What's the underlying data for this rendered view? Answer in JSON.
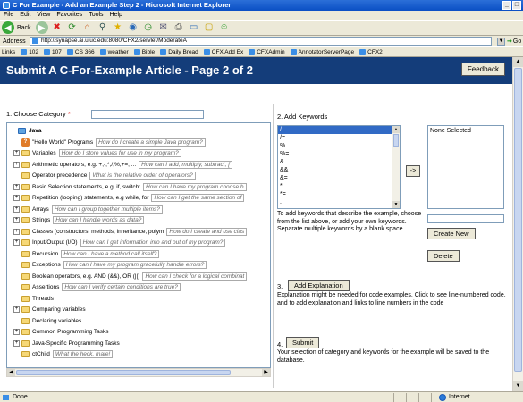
{
  "window": {
    "title": "C For Example - Add an Example Step 2 - Microsoft Internet Explorer",
    "buttons": [
      "_",
      "□"
    ]
  },
  "menu": [
    "File",
    "Edit",
    "View",
    "Favorites",
    "Tools",
    "Help"
  ],
  "toolbar": {
    "back_label": "Back"
  },
  "address": {
    "label": "Address",
    "url": "http://synapse.ai.uiuc.edu:8080/CFX2/servlet/ModerateA",
    "go_label": "Go"
  },
  "links": {
    "label": "Links",
    "items": [
      "102",
      "107",
      "CS 366",
      "weather",
      "Bible",
      "Daily Bread",
      "CFX Add Ex",
      "CFXAdmin",
      "AnnotatorServerPage",
      "CFX2"
    ]
  },
  "page": {
    "title": "Submit A C-For-Example Article - Page 2 of 2",
    "feedback_label": "Feedback"
  },
  "category": {
    "label": "1. Choose Category",
    "required_mark": "*",
    "value": "",
    "tree": [
      {
        "label": "Java",
        "bold": true,
        "icon": "root",
        "expand": "",
        "indent": 0
      },
      {
        "label": "\"Hello World\" Programs",
        "hint": "How do I create a simple Java program?",
        "icon": "q",
        "expand": "",
        "indent": 1
      },
      {
        "label": "Variables",
        "hint": "How do I store values for use in my program?",
        "icon": "folder",
        "expand": "+",
        "indent": 1
      },
      {
        "label": "Arithmetic operators, e.g. +,-,*,/,%,+=, ...",
        "hint": "How can I add, multiply, subtract, [",
        "icon": "folder",
        "expand": "+",
        "indent": 1
      },
      {
        "label": "Operator precedence",
        "hint": "What is the relative order of operators?",
        "icon": "folder",
        "expand": "",
        "indent": 1
      },
      {
        "label": "Basic Selection statements, e.g. if, switch:",
        "hint": "How can I have my program choose b",
        "icon": "folder",
        "expand": "+",
        "indent": 1
      },
      {
        "label": "Repetition (looping) statements, e.g while, for",
        "hint": "How can I get the same section of",
        "icon": "folder",
        "expand": "+",
        "indent": 1
      },
      {
        "label": "Arrays",
        "hint": "How can I group together multiple items?",
        "icon": "folder",
        "expand": "+",
        "indent": 1
      },
      {
        "label": "Strings",
        "hint": "How can I handle words as data?",
        "icon": "folder",
        "expand": "+",
        "indent": 1
      },
      {
        "label": "Classes (constructors, methods, inheritance, polym",
        "hint": "How do I create and use clas",
        "icon": "folder",
        "expand": "+",
        "indent": 1
      },
      {
        "label": "Input/Output (I/O)",
        "hint": "How can I get information into and out of my program?",
        "icon": "folder",
        "expand": "+",
        "indent": 1
      },
      {
        "label": "Recursion",
        "hint": "How can I have a method call itself?",
        "icon": "folder",
        "expand": "",
        "indent": 1
      },
      {
        "label": "Exceptions",
        "hint": "How can I have my program gracefully handle errors?",
        "icon": "folder",
        "expand": "",
        "indent": 1
      },
      {
        "label": "Boolean operators, e.g. AND (&&), OR (||)",
        "hint": "How can I check for a logical combinat",
        "icon": "folder",
        "expand": "",
        "indent": 1
      },
      {
        "label": "Assertions",
        "hint": "How can I verify certain conditions are true?",
        "icon": "folder",
        "expand": "",
        "indent": 1
      },
      {
        "label": "Threads",
        "hint": "",
        "icon": "folder",
        "expand": "",
        "indent": 1
      },
      {
        "label": "Comparing variables",
        "hint": "",
        "icon": "folder",
        "expand": "+",
        "indent": 1
      },
      {
        "label": "Declaring variables",
        "hint": "",
        "icon": "folder",
        "expand": "",
        "indent": 1
      },
      {
        "label": "Common Programming Tasks",
        "hint": "",
        "icon": "folder",
        "expand": "+",
        "indent": 1
      },
      {
        "label": "Java-Specific Programming Tasks",
        "hint": "",
        "icon": "folder",
        "expand": "+",
        "indent": 1
      },
      {
        "label": "ctChild",
        "hint": "What the heck, mate!",
        "icon": "folder",
        "expand": "",
        "indent": 1
      }
    ]
  },
  "keywords": {
    "label": "2. Add Keywords",
    "options": [
      "/",
      "/=",
      "%",
      "%=",
      "&",
      "&&",
      "&=",
      "*",
      "*=",
      "."
    ],
    "selected_index": 0,
    "move_label": "->",
    "selected_placeholder": "None Selected",
    "instructions": "To add keywords that describe the example, choose from the list above, or add your own keywords. Separate multiple keywords by a blank space",
    "new_keyword_value": "",
    "create_label": "Create New",
    "delete_label": "Delete"
  },
  "explanation": {
    "number": "3.",
    "button_label": "Add Explanation",
    "text": "Explanation might be needed for code examples. Click to see line-numbered code, and to add explanation and links to line numbers in the code"
  },
  "submit": {
    "number": "4.",
    "button_label": "Submit",
    "text": "Your selection of category and keywords for the example will be saved to the database."
  },
  "status": {
    "text": "Done",
    "zone": "Internet"
  }
}
